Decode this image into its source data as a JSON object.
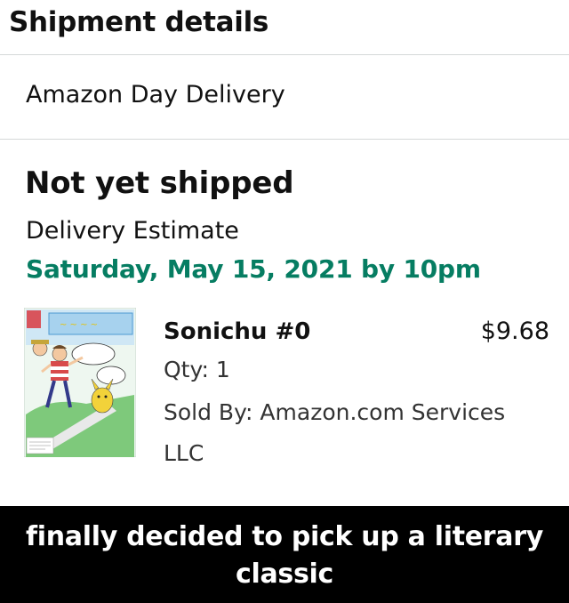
{
  "shipment": {
    "heading": "Shipment details",
    "delivery_type": "Amazon Day Delivery",
    "status": "Not yet shipped",
    "estimate_label": "Delivery Estimate",
    "estimate_date": "Saturday, May 15, 2021 by 10pm"
  },
  "item": {
    "title": "Sonichu #0",
    "price": "$9.68",
    "quantity": "Qty: 1",
    "seller": "Sold By: Amazon.com Services LLC",
    "thumbnail_icon": "comic-book-cover-icon"
  },
  "caption": {
    "text": "finally decided to pick up a literary classic"
  },
  "colors": {
    "delivery_green": "#067d62",
    "divider": "#d5d9d9",
    "caption_background": "#000000",
    "caption_text": "#ffffff"
  }
}
